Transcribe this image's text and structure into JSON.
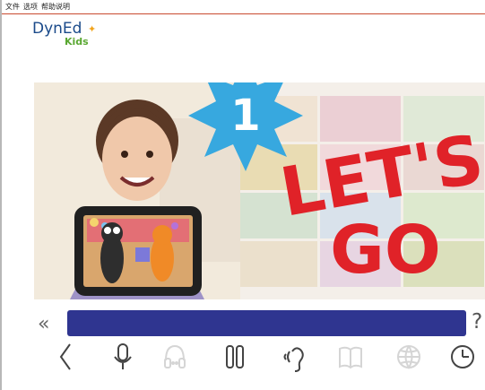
{
  "menubar": {
    "items": [
      "文件",
      "选项",
      "帮助说明"
    ]
  },
  "logo": {
    "brand": "DynEd",
    "kids": "Kids"
  },
  "lesson": {
    "badge_number": "1",
    "title_line1": "LET'S",
    "title_line2": "GO"
  },
  "controls": {
    "rewind_label": "«",
    "help_label": "?"
  },
  "toolbar": {
    "items": [
      "back-icon",
      "microphone-icon",
      "headphones-icon",
      "pause-icon",
      "ear-icon",
      "book-icon",
      "globe-icon",
      "clock-icon"
    ]
  },
  "colors": {
    "progress": "#2f3590",
    "accent_red": "#e02228",
    "badge_blue": "#37a8df",
    "menu_border": "#c94a2f"
  }
}
